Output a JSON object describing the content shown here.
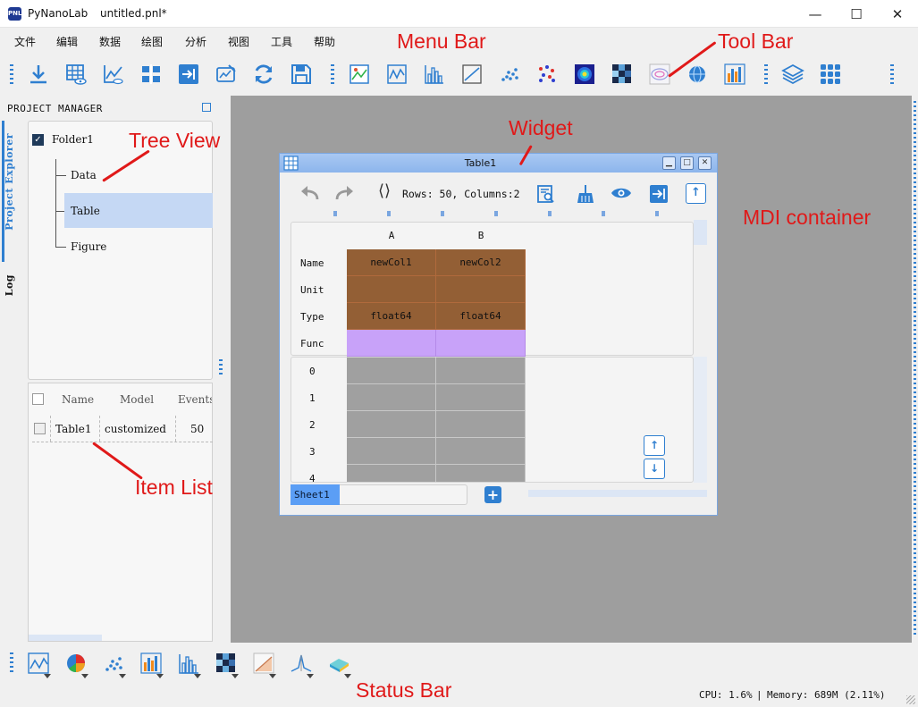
{
  "window": {
    "app_name": "PyNanoLab",
    "app_icon_text": "PNL",
    "doc_name": "untitled.pnl*",
    "minimize": "—",
    "maximize": "☐",
    "close": "✕"
  },
  "menu": [
    "文件",
    "编辑",
    "数据",
    "绘图",
    "分析",
    "视图",
    "工具",
    "帮助"
  ],
  "toolbar_icons": [
    "download-icon",
    "table-view-icon",
    "line-chart-icon",
    "split-icon",
    "import-icon",
    "edit-chart-icon",
    "refresh-icon",
    "save-icon",
    "image-chart-icon",
    "line-plot-icon",
    "histogram-icon",
    "linear-plot-icon",
    "scatter-plot-icon",
    "dots-plot-icon",
    "heatmap-icon",
    "pixel-map-icon",
    "contour-icon",
    "globe-icon",
    "bar-chart-icon",
    "layers-icon",
    "grid-apps-icon"
  ],
  "project_manager": {
    "title": "PROJECT MANAGER",
    "tabs": [
      "Project Explorer",
      "Log"
    ],
    "tree": {
      "root": "Folder1",
      "children": [
        "Data",
        "Table",
        "Figure"
      ],
      "selected": "Table"
    },
    "item_list": {
      "headers": [
        "Name",
        "Model",
        "Events"
      ],
      "rows": [
        {
          "name": "Table1",
          "model": "customized",
          "events": "50"
        }
      ]
    }
  },
  "widget": {
    "title": "Table1",
    "info": "Rows: 50, Columns:2",
    "columns": [
      "A",
      "B"
    ],
    "header_rows": [
      {
        "label": "Name",
        "values": [
          "newCol1",
          "newCol2"
        ]
      },
      {
        "label": "Unit",
        "values": [
          "",
          ""
        ]
      },
      {
        "label": "Type",
        "values": [
          "float64",
          "float64"
        ]
      },
      {
        "label": "Func",
        "values": [
          "",
          ""
        ]
      }
    ],
    "row_numbers": [
      "0",
      "1",
      "2",
      "3",
      "4"
    ],
    "sheet_tab": "Sheet1",
    "add_sheet": "+",
    "colors": {
      "header_cell": "#935f35",
      "func_cell": "#c8a2f9",
      "data_cell": "#a0a0a0"
    }
  },
  "status_icons": [
    "line-plot-icon",
    "pie-chart-icon",
    "scatter-plot-icon",
    "bar-chart-icon",
    "histogram-icon",
    "pixel-map-icon",
    "fill-area-icon",
    "peak-icon",
    "surface-3d-icon"
  ],
  "status": {
    "cpu": "CPU: 1.6%",
    "memory": "Memory:  689M (2.11%)"
  },
  "annotations": {
    "menu_bar": "Menu Bar",
    "tool_bar": "Tool Bar",
    "tree_view": "Tree View",
    "widget": "Widget",
    "mdi": "MDI container",
    "item_list": "Item List",
    "status_bar": "Status Bar"
  },
  "accent_color": "#2f7fd0",
  "annotation_color": "#e01919"
}
